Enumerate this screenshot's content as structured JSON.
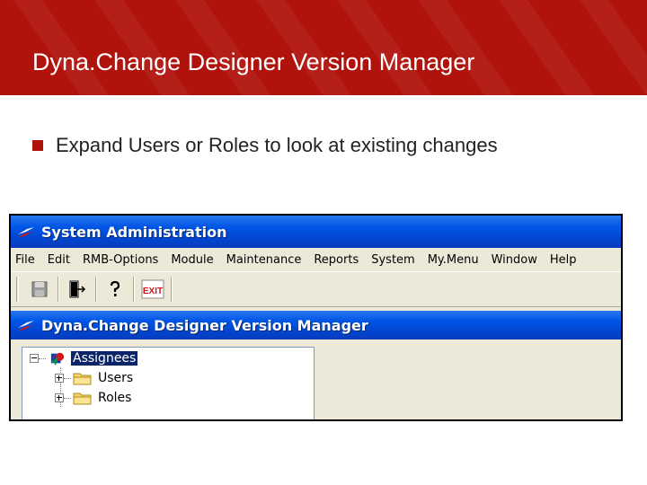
{
  "slide": {
    "title": "Dyna.Change Designer Version Manager",
    "bullet": "Expand Users or Roles to look at existing changes",
    "accent_color": "#b0120c"
  },
  "app": {
    "window_title": "System Administration",
    "menu": [
      "File",
      "Edit",
      "RMB-Options",
      "Module",
      "Maintenance",
      "Reports",
      "System",
      "My.Menu",
      "Window",
      "Help"
    ],
    "toolbar": [
      {
        "icon": "save-icon"
      },
      {
        "icon": "enter-icon"
      },
      {
        "icon": "help-icon"
      },
      {
        "icon": "exit-icon",
        "label": "EXIT"
      }
    ],
    "child_window": {
      "title": "Dyna.Change Designer Version Manager",
      "tree": {
        "root": {
          "label": "Assignees",
          "expanded": true,
          "selected": true
        },
        "children": [
          {
            "label": "Users",
            "expanded": false
          },
          {
            "label": "Roles",
            "expanded": false
          }
        ]
      }
    },
    "titlebar_color": "#0055e5",
    "window_bg": "#ece9d8"
  }
}
